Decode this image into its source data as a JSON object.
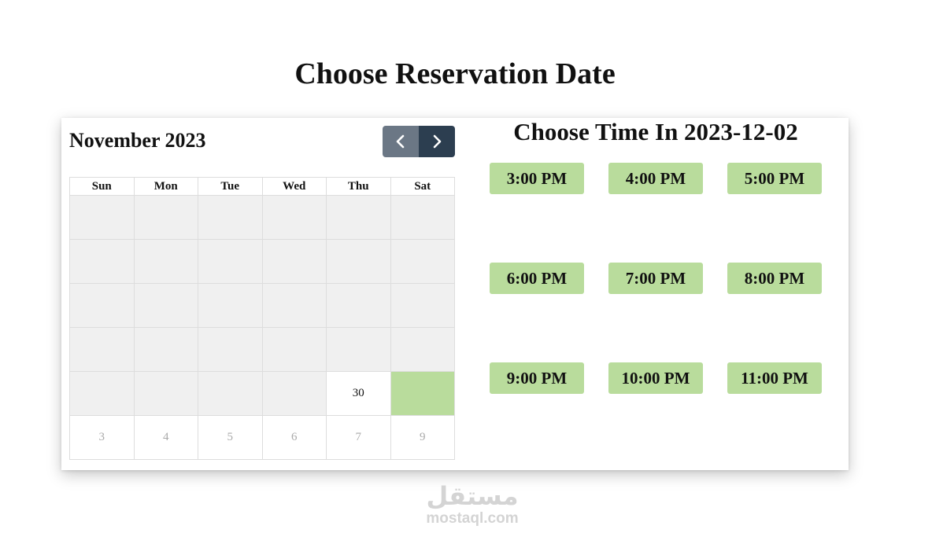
{
  "page": {
    "title": "Choose Reservation Date"
  },
  "calendar": {
    "month_title": "November 2023",
    "weekdays": [
      "Sun",
      "Mon",
      "Tue",
      "Wed",
      "Thu",
      "Sat"
    ],
    "rows": [
      [
        "",
        "",
        "",
        "",
        "",
        ""
      ],
      [
        "",
        "",
        "",
        "",
        "",
        ""
      ],
      [
        "",
        "",
        "",
        "",
        "",
        ""
      ],
      [
        "",
        "",
        "",
        "",
        "",
        ""
      ],
      [
        "",
        "",
        "",
        "",
        "30",
        ""
      ],
      [
        "3",
        "4",
        "5",
        "6",
        "7",
        "9"
      ]
    ],
    "prev_icon": "chevron-left-icon",
    "next_icon": "chevron-right-icon",
    "selected_color": "#b9dc9c",
    "prev_color": "#6b7785",
    "next_color": "#2c3e50"
  },
  "times": {
    "title": "Choose Time In 2023-12-02",
    "slots": [
      "3:00 PM",
      "4:00 PM",
      "5:00 PM",
      "6:00 PM",
      "7:00 PM",
      "8:00 PM",
      "9:00 PM",
      "10:00 PM",
      "11:00 PM"
    ],
    "slot_color": "#b9dc9c"
  },
  "watermark": {
    "arabic": "مستقل",
    "latin": "mostaql.com"
  }
}
